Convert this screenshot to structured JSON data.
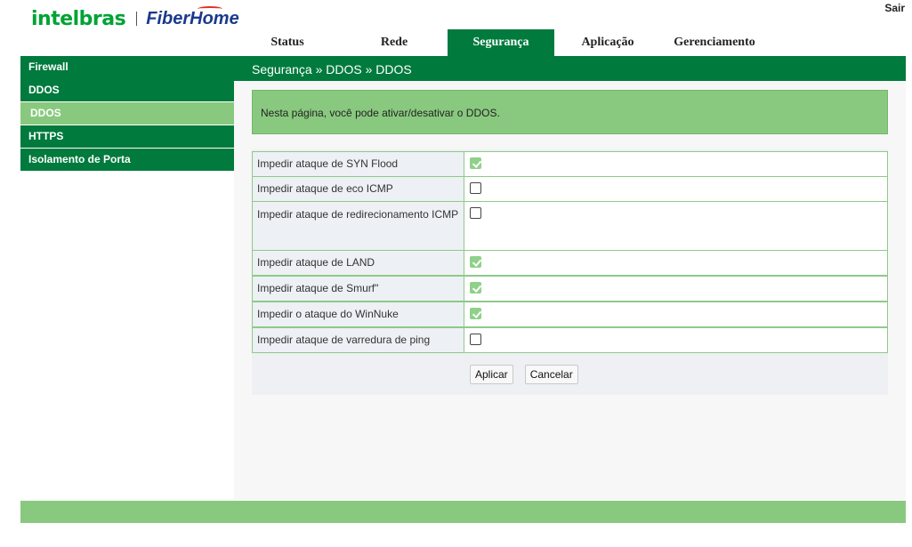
{
  "brand": {
    "logo_left": "intelbras",
    "logo_right": "FiberHome"
  },
  "header": {
    "logout_label": "Sair"
  },
  "top_nav": [
    {
      "label": "Status",
      "active": false
    },
    {
      "label": "Rede",
      "active": false
    },
    {
      "label": "Segurança",
      "active": true
    },
    {
      "label": "Aplicação",
      "active": false
    },
    {
      "label": "Gerenciamento",
      "active": false
    }
  ],
  "breadcrumb": "Segurança » DDOS » DDOS",
  "sidebar": {
    "items": [
      {
        "label": "Firewall",
        "type": "section"
      },
      {
        "label": "DDOS",
        "type": "section"
      },
      {
        "label": "DDOS",
        "type": "sub",
        "selected": true
      },
      {
        "label": "HTTPS",
        "type": "section"
      },
      {
        "label": "Isolamento de Porta",
        "type": "section"
      }
    ]
  },
  "info_text": "Nesta página, você pode ativar/desativar o DDOS.",
  "options": [
    {
      "label": "Impedir ataque de SYN Flood",
      "checked": true
    },
    {
      "label": "Impedir ataque de eco ICMP",
      "checked": false
    },
    {
      "label": "Impedir ataque de redirecionamento ICMP",
      "checked": false
    },
    {
      "label": "Impedir ataque de LAND",
      "checked": true
    },
    {
      "label": "Impedir ataque de Smurf\"",
      "checked": true
    },
    {
      "label": "Impedir o ataque do WinNuke",
      "checked": true
    },
    {
      "label": "Impedir ataque de varredura de ping",
      "checked": false
    }
  ],
  "buttons": {
    "apply_label": "Aplicar",
    "cancel_label": "Cancelar"
  },
  "colors": {
    "primary_green": "#007a3d",
    "light_green": "#89c97f",
    "checkbox_checked": "#8fd08a",
    "border_green": "#8fc98a"
  }
}
